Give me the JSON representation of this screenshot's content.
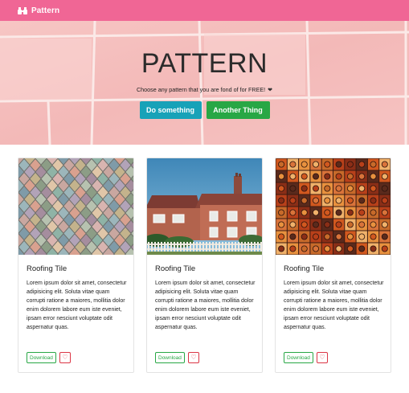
{
  "navbar": {
    "brand": "Pattern",
    "brand_icon": "binoculars-icon",
    "color": "#f06695"
  },
  "hero": {
    "title": "PATTERN",
    "subtitle": "Choose any pattern that you are fond of for FREE!",
    "subtitle_icon": "heart-icon",
    "primary_button": "Do something",
    "secondary_button": "Another Thing",
    "primary_color": "#17a2b8",
    "secondary_color": "#28a745",
    "background": "pink-tile-photo"
  },
  "cards": [
    {
      "image": "colorful-roof-tiles-photo",
      "title": "Roofing Tile",
      "text": "Lorem ipsum dolor sit amet, consectetur adipisicing elit. Soluta vitae quam corrupti ratione a maiores, mollitia dolor enim dolorem labore eum iste eveniet, ipsam error nesciunt voluptate odit aspernatur quas.",
      "download_label": "Download",
      "favorite_icon": "heart-outline-icon"
    },
    {
      "image": "brick-house-photo",
      "title": "Roofing Tile",
      "text": "Lorem ipsum dolor sit amet, consectetur adipisicing elit. Soluta vitae quam corrupti ratione a maiores, mollitia dolor enim dolorem labore eum iste eveniet, ipsam error nesciunt voluptate odit aspernatur quas.",
      "download_label": "Download",
      "favorite_icon": "heart-outline-icon"
    },
    {
      "image": "ornate-tiles-photo",
      "title": "Roofing Tile",
      "text": "Lorem ipsum dolor sit amet, consectetur adipisicing elit. Soluta vitae quam corrupti ratione a maiores, mollitia dolor enim dolorem labore eum iste eveniet, ipsam error nesciunt voluptate odit aspernatur quas.",
      "download_label": "Download",
      "favorite_icon": "heart-outline-icon"
    }
  ]
}
